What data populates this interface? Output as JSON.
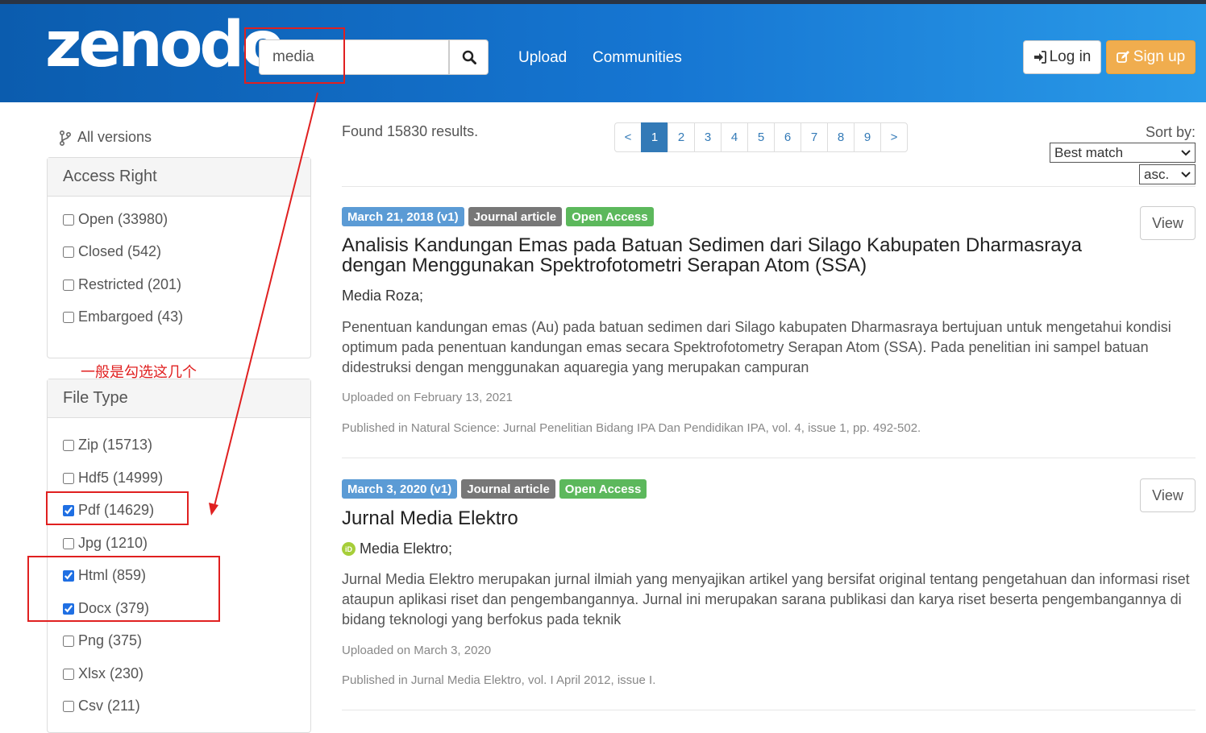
{
  "header": {
    "logo": "zenodo",
    "search_value": "media",
    "nav": [
      "Upload",
      "Communities"
    ],
    "login_label": "Log in",
    "signup_label": "Sign up"
  },
  "sidebar": {
    "all_versions": "All versions",
    "access_right": {
      "title": "Access Right",
      "items": [
        {
          "label": "Open (33980)",
          "checked": false
        },
        {
          "label": "Closed (542)",
          "checked": false
        },
        {
          "label": "Restricted (201)",
          "checked": false
        },
        {
          "label": "Embargoed (43)",
          "checked": false
        }
      ]
    },
    "file_type": {
      "title": "File Type",
      "items": [
        {
          "label": "Zip (15713)",
          "checked": false
        },
        {
          "label": "Hdf5 (14999)",
          "checked": false
        },
        {
          "label": "Pdf (14629)",
          "checked": true
        },
        {
          "label": "Jpg (1210)",
          "checked": false
        },
        {
          "label": "Html (859)",
          "checked": true
        },
        {
          "label": "Docx (379)",
          "checked": true
        },
        {
          "label": "Png (375)",
          "checked": false
        },
        {
          "label": "Xlsx (230)",
          "checked": false
        },
        {
          "label": "Csv (211)",
          "checked": false
        }
      ]
    }
  },
  "annotation": {
    "note": "一般是勾选这几个",
    "color": "#e02020"
  },
  "results": {
    "found": "Found 15830 results.",
    "pages": [
      "<",
      "1",
      "2",
      "3",
      "4",
      "5",
      "6",
      "7",
      "8",
      "9",
      ">"
    ],
    "active_page": "1",
    "sort_label": "Sort by:",
    "sort_value": "Best match",
    "order_value": "asc.",
    "view_label": "View",
    "items": [
      {
        "date": "March 21, 2018 (v1)",
        "type": "Journal article",
        "access": "Open Access",
        "title": "Analisis Kandungan Emas pada Batuan Sedimen dari Silago Kabupaten Dharmasraya dengan Menggunakan Spektrofotometri Serapan Atom (SSA)",
        "authors": "Media Roza;",
        "description": "Penentuan kandungan emas (Au) pada batuan sedimen dari Silago kabupaten Dharmasraya bertujuan untuk mengetahui kondisi optimum pada penentuan kandungan emas secara Spektrofotometry Serapan Atom (SSA). Pada penelitian ini sampel batuan didestruksi dengan menggunakan aquaregia yang merupakan campuran",
        "uploaded": "Uploaded on February 13, 2021",
        "published": "Published in Natural Science: Jurnal Penelitian Bidang IPA Dan Pendidikan IPA, vol. 4, issue 1, pp. 492-502."
      },
      {
        "date": "March 3, 2020 (v1)",
        "type": "Journal article",
        "access": "Open Access",
        "title": "Jurnal Media Elektro",
        "authors": "Media Elektro;",
        "description": "Jurnal Media Elektro merupakan jurnal ilmiah yang menyajikan artikel yang bersifat original tentang pengetahuan dan informasi riset ataupun aplikasi riset dan pengembangannya. Jurnal ini merupakan sarana publikasi dan karya riset beserta pengembangannya di bidang teknologi yang berfokus pada teknik",
        "uploaded": "Uploaded on March 3, 2020",
        "published": "Published in Jurnal Media Elektro, vol. I April 2012, issue I."
      }
    ]
  }
}
